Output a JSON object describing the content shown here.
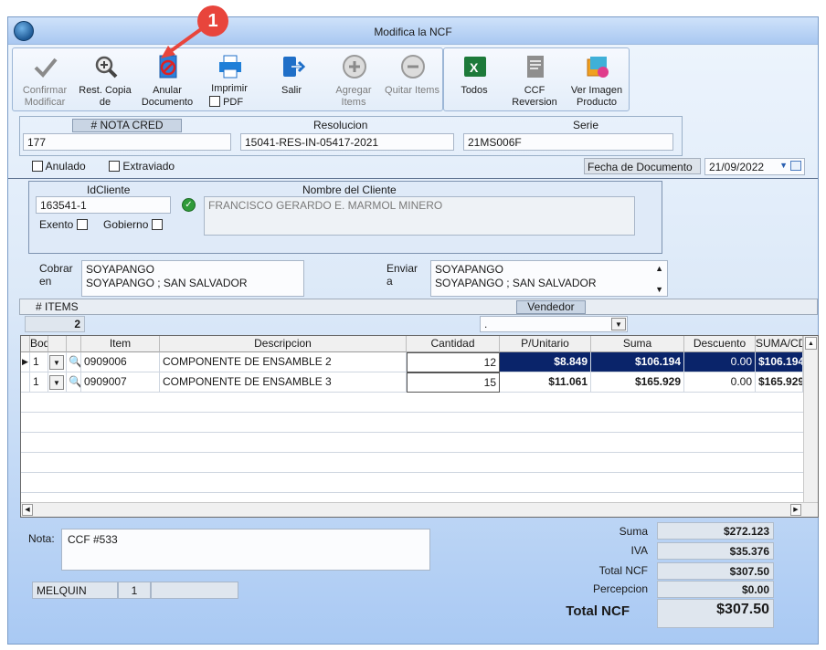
{
  "window": {
    "title": "Modifica la NCF"
  },
  "callout": {
    "number": "1"
  },
  "toolbar": {
    "buttons": [
      {
        "label": "Confirmar Modificar",
        "icon": "check-icon",
        "enabled": false
      },
      {
        "label": "Rest. Copia de",
        "icon": "zoom-icon",
        "enabled": true
      },
      {
        "label": "Anular Documento",
        "icon": "cancel-document-icon",
        "enabled": true
      },
      {
        "label": "Imprimir",
        "icon": "printer-icon",
        "enabled": true
      },
      {
        "label": "Salir",
        "icon": "exit-icon",
        "enabled": true
      },
      {
        "label": "Agregar Items",
        "icon": "plus-circle-icon",
        "enabled": false
      },
      {
        "label": "Quitar Items",
        "icon": "minus-circle-icon",
        "enabled": false
      }
    ],
    "pdf_label": "PDF",
    "buttons2": [
      {
        "label": "Todos",
        "icon": "excel-icon"
      },
      {
        "label": "CCF Reversion",
        "icon": "document-icon"
      },
      {
        "label": "Ver Imagen Producto",
        "icon": "image-icon"
      }
    ]
  },
  "header": {
    "nota_cred_label": "# NOTA CRED",
    "nota_cred_value": "177",
    "resolucion_label": "Resolucion",
    "resolucion_value": "15041-RES-IN-05417-2021",
    "serie_label": "Serie",
    "serie_value": "21MS006F",
    "anulado_label": "Anulado",
    "extraviado_label": "Extraviado",
    "fecha_label": "Fecha de  Documento",
    "fecha_value": "21/09/2022"
  },
  "client": {
    "id_label": "IdCliente",
    "id_value": "163541-1",
    "name_label": "Nombre del Cliente",
    "name_value": "FRANCISCO GERARDO E. MARMOL MINERO",
    "exento_label": "Exento",
    "gobierno_label": "Gobierno"
  },
  "address": {
    "cobrar_label": "Cobrar en",
    "cobrar_line1": "SOYAPANGO",
    "cobrar_line2": "SOYAPANGO ; SAN SALVADOR",
    "enviar_label": "Enviar a",
    "enviar_line1": "SOYAPANGO",
    "enviar_line2": "SOYAPANGO ; SAN SALVADOR"
  },
  "items_bar": {
    "items_label": "# ITEMS",
    "items_count": "2",
    "vendedor_label": "Vendedor",
    "vendedor_value": "."
  },
  "grid": {
    "columns": [
      "Bodega",
      "",
      "",
      "Item",
      "Descripcion",
      "Cantidad",
      "P/Unitario",
      "Suma",
      "Descuento",
      "SUMA/CDESC"
    ],
    "rows": [
      {
        "bodega": "1",
        "item": "0909006",
        "descripcion": "COMPONENTE DE ENSAMBLE 2",
        "cantidad": "12",
        "p_unitario": "$8.849",
        "suma": "$106.194",
        "descuento": "0.00",
        "suma_cdesc": "$106.194"
      },
      {
        "bodega": "1",
        "item": "0909007",
        "descripcion": "COMPONENTE DE ENSAMBLE 3",
        "cantidad": "15",
        "p_unitario": "$11.061",
        "suma": "$165.929",
        "descuento": "0.00",
        "suma_cdesc": "$165.929"
      }
    ]
  },
  "nota": {
    "label": "Nota:",
    "value": "CCF  #533"
  },
  "status": {
    "user": "MELQUIN",
    "num": "1",
    "extra": ""
  },
  "totals": {
    "suma_label": "Suma",
    "suma_value": "$272.123",
    "iva_label": "IVA",
    "iva_value": "$35.376",
    "total_ncf_small_label": "Total NCF",
    "total_ncf_small_value": "$307.50",
    "percepcion_label": "Percepcion",
    "percepcion_value": "$0.00",
    "total_label": "Total NCF",
    "total_value": "$307.50"
  }
}
